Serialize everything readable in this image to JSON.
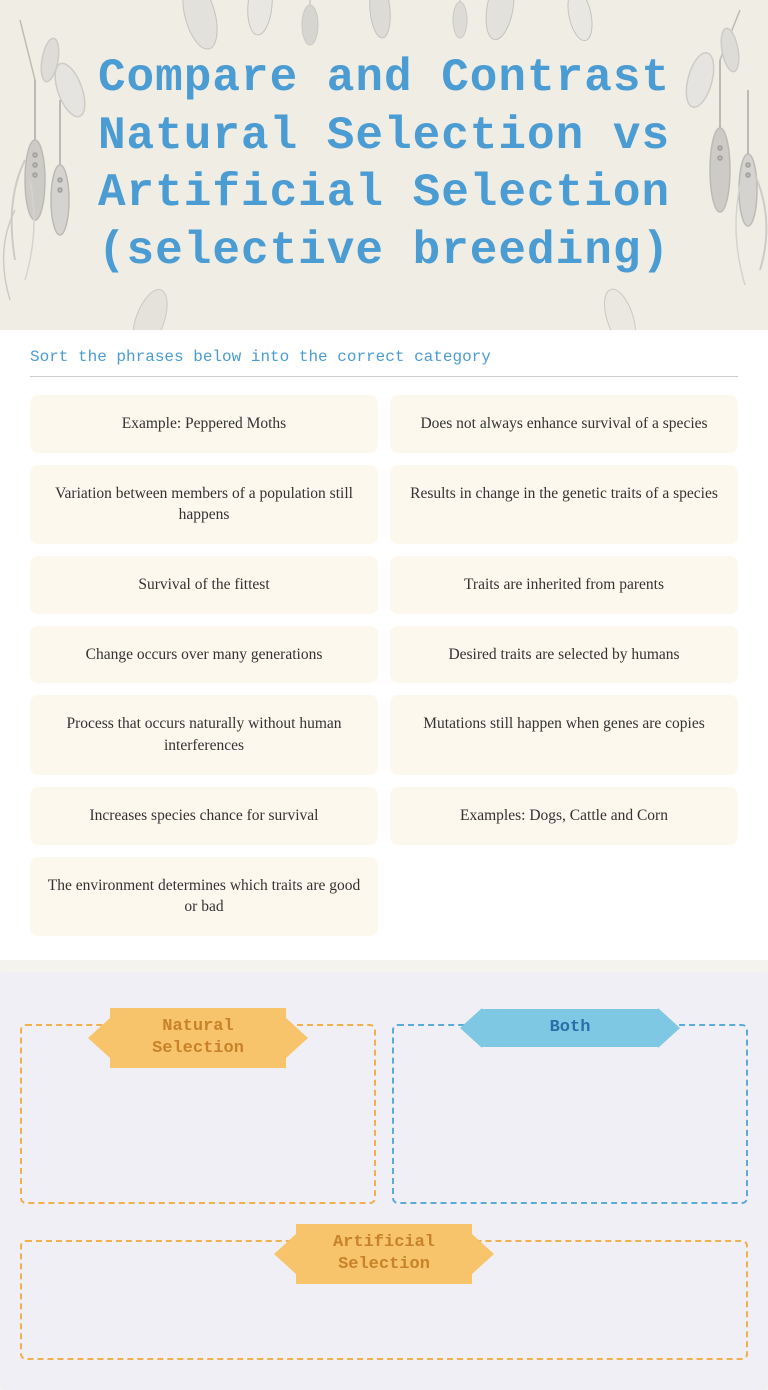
{
  "header": {
    "title": "Compare and Contrast Natural Selection vs Artificial Selection (selective breeding)"
  },
  "sort_instruction": "Sort the phrases below into the correct category",
  "cards": [
    {
      "id": "c1",
      "text": "Example: Peppered Moths"
    },
    {
      "id": "c2",
      "text": "Does not always enhance survival of a species"
    },
    {
      "id": "c3",
      "text": "Variation between members of a population still happens"
    },
    {
      "id": "c4",
      "text": "Results in change in the genetic traits of a species"
    },
    {
      "id": "c5",
      "text": "Survival of the fittest"
    },
    {
      "id": "c6",
      "text": "Traits are inherited from parents"
    },
    {
      "id": "c7",
      "text": "Change occurs over many generations"
    },
    {
      "id": "c8",
      "text": "Desired traits are selected by humans"
    },
    {
      "id": "c9",
      "text": "Process that occurs naturally without human interferences"
    },
    {
      "id": "c10",
      "text": "Mutations still happen when genes are copies"
    },
    {
      "id": "c11",
      "text": "Increases species chance for survival"
    },
    {
      "id": "c12",
      "text": "Examples: Dogs, Cattle and Corn"
    },
    {
      "id": "c13",
      "text": "The environment determines which traits are good or bad"
    }
  ],
  "categories": {
    "natural_selection": {
      "label_line1": "Natural",
      "label_line2": "Selection"
    },
    "both": {
      "label": "Both"
    },
    "artificial_selection": {
      "label_line1": "Artificial",
      "label_line2": "Selection"
    }
  }
}
